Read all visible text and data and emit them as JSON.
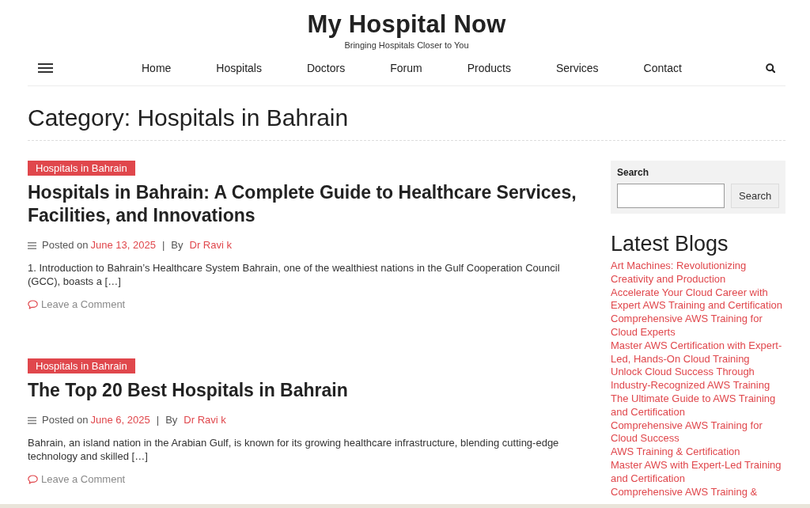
{
  "site": {
    "title": "My Hospital Now",
    "tagline": "Bringing Hospitals Closer to You"
  },
  "nav": {
    "items": [
      "Home",
      "Hospitals",
      "Doctors",
      "Forum",
      "Products",
      "Services",
      "Contact"
    ]
  },
  "page_title": "Category: Hospitals in Bahrain",
  "posts": [
    {
      "category": "Hospitals in Bahrain",
      "title": "Hospitals in Bahrain: A Complete Guide to Healthcare Services, Facilities, and Innovations",
      "posted_label": "Posted on",
      "date": "June 13, 2025",
      "separator": "|",
      "by_label": "By",
      "author": "Dr Ravi k",
      "excerpt": "1. Introduction to Bahrain’s Healthcare System Bahrain, one of the wealthiest nations in the Gulf Cooperation Council (GCC), boasts a […]",
      "comment_link": "Leave a Comment"
    },
    {
      "category": "Hospitals in Bahrain",
      "title": "The Top 20 Best Hospitals in Bahrain",
      "posted_label": "Posted on",
      "date": "June 6, 2025",
      "separator": "|",
      "by_label": "By",
      "author": "Dr Ravi k",
      "excerpt": "Bahrain, an island nation in the Arabian Gulf, is known for its growing healthcare infrastructure, blending cutting-edge technology and skilled […]",
      "comment_link": "Leave a Comment"
    }
  ],
  "sidebar": {
    "search": {
      "label": "Search",
      "button": "Search"
    },
    "latest_blogs": {
      "title": "Latest Blogs",
      "links": [
        "Art Machines: Revolutionizing Creativity and Production",
        "Accelerate Your Cloud Career with Expert AWS Training and Certification",
        "Comprehensive AWS Training for Cloud Experts",
        "Master AWS Certification with Expert-Led, Hands-On Cloud Training",
        "Unlock Cloud Success Through Industry-Recognized AWS Training",
        "The Ultimate Guide to AWS Training and Certification",
        "Comprehensive AWS Training for Cloud Success",
        "AWS Training & Certification",
        "Master AWS with Expert-Led Training and Certification",
        "Comprehensive AWS Training &"
      ]
    }
  }
}
